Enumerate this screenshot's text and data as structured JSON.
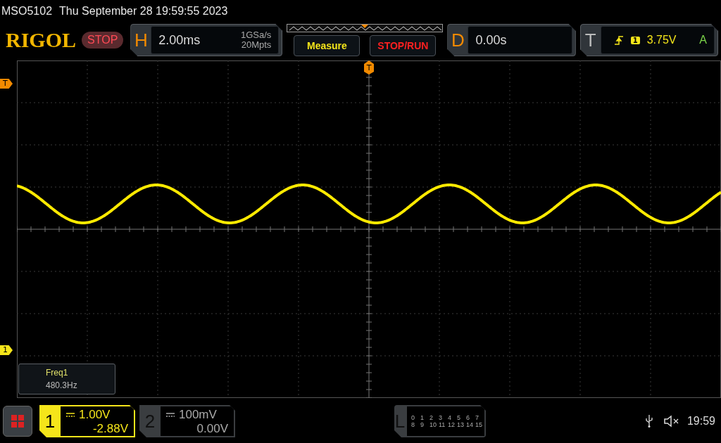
{
  "status_line": {
    "model": "MSO5102",
    "datetime": "Thu September 28 19:59:55 2023"
  },
  "logo": "RIGOL",
  "run_state": {
    "label": "STOP",
    "kind": "stop"
  },
  "horizontal": {
    "letter": "H",
    "timebase": "2.00ms",
    "sample_rate": "1GSa/s",
    "memory_depth": "20Mpts"
  },
  "buttons": [
    {
      "label": "Measure",
      "kind": "measure"
    },
    {
      "label": "STOP/RUN",
      "kind": "stoprun"
    }
  ],
  "delay": {
    "letter": "D",
    "value": "0.00s"
  },
  "trigger": {
    "letter": "T",
    "source": "1",
    "level": "3.75V",
    "mode": "A"
  },
  "top_marker": {
    "label": "T"
  },
  "side_markers": [
    {
      "label": "T",
      "kind": "trigger"
    },
    {
      "label": "1",
      "kind": "channel"
    }
  ],
  "measurements": [
    {
      "name": "Freq1",
      "value": "480.3Hz"
    }
  ],
  "channels": [
    {
      "number": "1",
      "scale": "1.00V",
      "offset": "-2.88V",
      "selected": true
    },
    {
      "number": "2",
      "scale": "100mV",
      "offset": "0.00V",
      "selected": false
    }
  ],
  "logic": {
    "letter": "L",
    "rows": [
      [
        "0",
        "1",
        "2",
        "3",
        "4",
        "5",
        "6",
        "7"
      ],
      [
        "8",
        "9",
        "10",
        "11",
        "12",
        "13",
        "14",
        "15"
      ]
    ]
  },
  "status_bar": {
    "time": "19:59",
    "muted": true
  }
}
